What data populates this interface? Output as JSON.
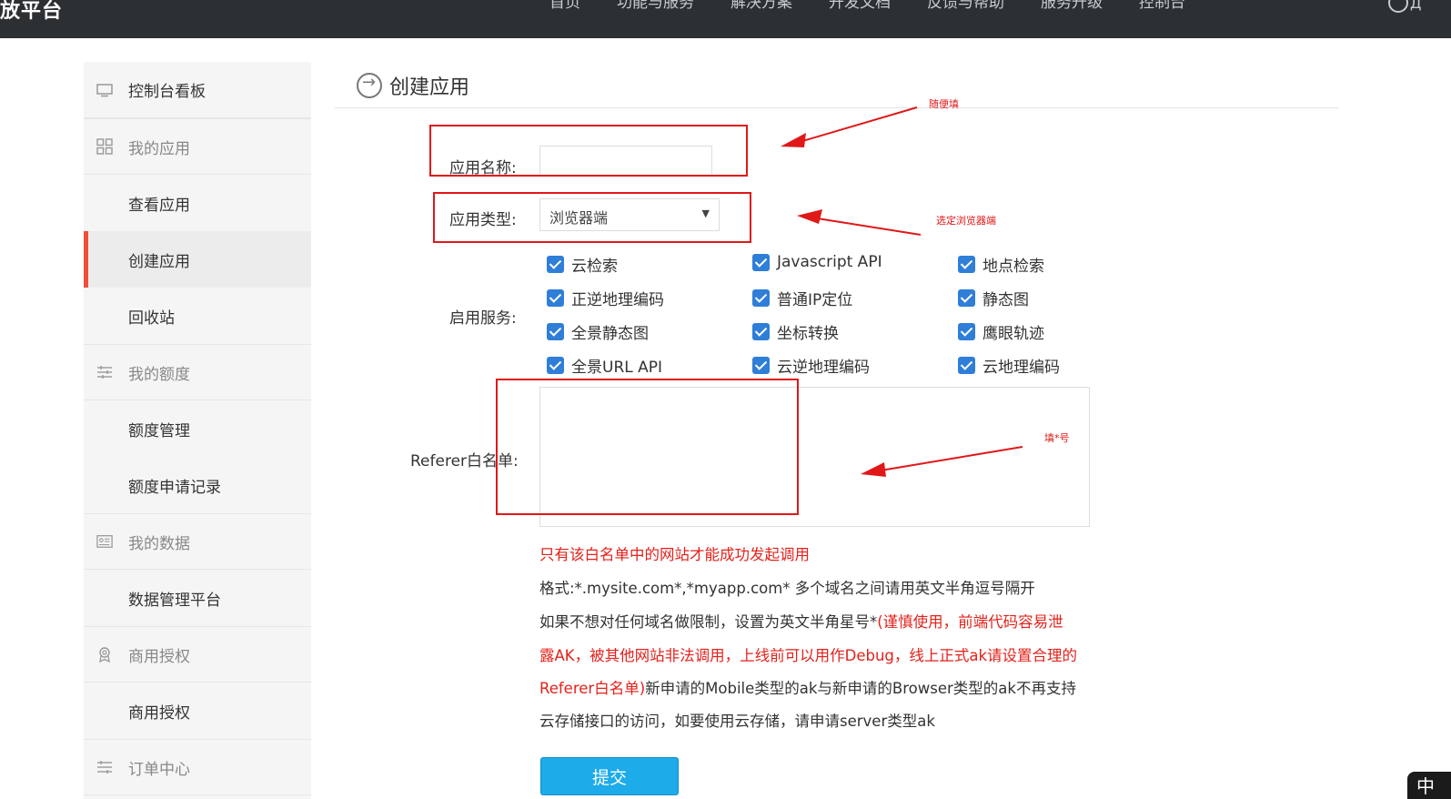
{
  "brand": "放平台",
  "nav": [
    "首页",
    "功能与服务",
    "解决方案",
    "开发文档",
    "反馈与帮助",
    "服务升级",
    "控制台"
  ],
  "user_label": "Д",
  "sidebar": [
    {
      "label": "控制台看板",
      "icon": "monitor-icon",
      "group": true
    },
    {
      "label": "我的应用",
      "icon": "grid-icon",
      "group": true
    },
    {
      "label": "查看应用"
    },
    {
      "label": "创建应用",
      "active": true
    },
    {
      "label": "回收站"
    },
    {
      "label": "我的额度",
      "icon": "sliders-icon",
      "group": true
    },
    {
      "label": "额度管理"
    },
    {
      "label": "额度申请记录"
    },
    {
      "label": "我的数据",
      "icon": "id-card-icon",
      "group": true
    },
    {
      "label": "数据管理平台"
    },
    {
      "label": "商用授权",
      "icon": "award-icon",
      "group": true
    },
    {
      "label": "商用授权"
    },
    {
      "label": "订单中心",
      "icon": "list-icon",
      "group": true
    }
  ],
  "page_title": "创建应用",
  "form": {
    "app_name_label": "应用名称:",
    "app_name_value": "",
    "app_type_label": "应用类型:",
    "app_type_value": "浏览器端",
    "services_label": "启用服务:",
    "services": [
      "云检索",
      "Javascript API",
      "地点检索",
      "正逆地理编码",
      "普通IP定位",
      "静态图",
      "全景静态图",
      "坐标转换",
      "鹰眼轨迹",
      "全景URL API",
      "云逆地理编码",
      "云地理编码"
    ],
    "referer_label": "Referer白名单:",
    "referer_value": ""
  },
  "notes": {
    "line1": "只有该白名单中的网站才能成功发起调用",
    "line2": "格式:*.mysite.com*,*myapp.com* 多个域名之间请用英文半角逗号隔开",
    "line3_a": "如果不想对任何域名做限制，设置为英文半角星号*",
    "line3_b": "(谨慎使用，前端代码容易泄",
    "line4": "露AK，被其他网站非法调用，上线前可以用作Debug，线上正式ak请设置合理的",
    "line5_a": "Referer白名单)",
    "line5_b": "新申请的Mobile类型的ak与新申请的Browser类型的ak不再支持",
    "line6": "云存储接口的访问，如要使用云存储，请申请server类型ak"
  },
  "submit_label": "提交",
  "annotations": {
    "a1": "随便填",
    "a2": "选定浏览器端",
    "a3": "填*号"
  },
  "corner_text": "中",
  "colors": {
    "accent_red": "#e4211b",
    "submit_blue": "#1dabe9",
    "checkbox_blue": "#2f7ed8",
    "topbar": "#2c3033"
  }
}
